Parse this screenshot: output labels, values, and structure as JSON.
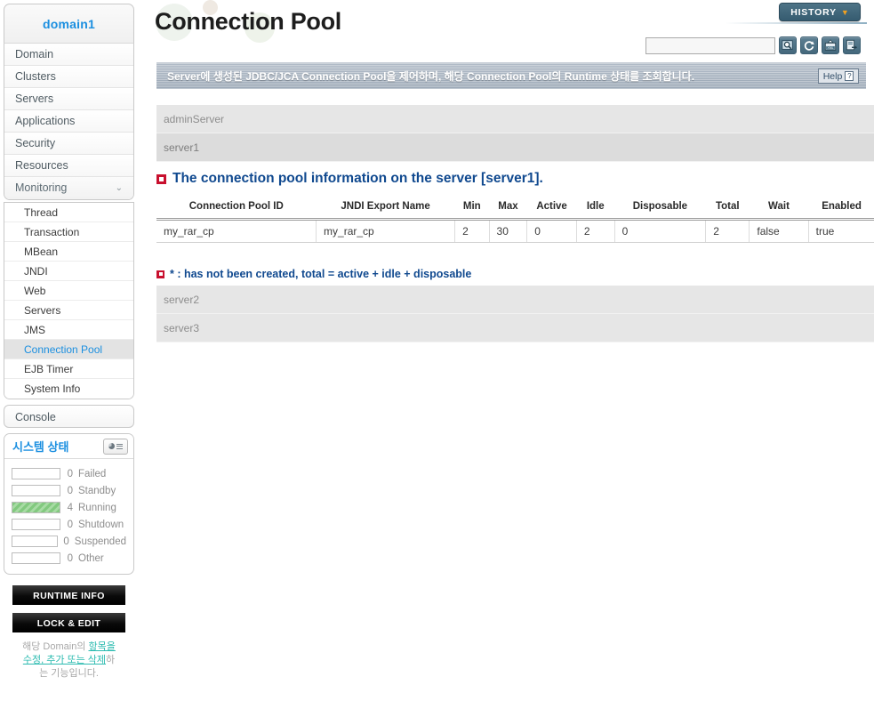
{
  "sidebar": {
    "domain_label": "domain1",
    "nav_items": [
      {
        "label": "Domain",
        "expandable": false
      },
      {
        "label": "Clusters",
        "expandable": false
      },
      {
        "label": "Servers",
        "expandable": false
      },
      {
        "label": "Applications",
        "expandable": false
      },
      {
        "label": "Security",
        "expandable": false
      },
      {
        "label": "Resources",
        "expandable": false
      },
      {
        "label": "Monitoring",
        "expandable": true,
        "chevron": "chevron-down-icon"
      }
    ],
    "sub_items": [
      {
        "label": "Thread",
        "active": false
      },
      {
        "label": "Transaction",
        "active": false
      },
      {
        "label": "MBean",
        "active": false
      },
      {
        "label": "JNDI",
        "active": false
      },
      {
        "label": "Web",
        "active": false
      },
      {
        "label": "Servers",
        "active": false
      },
      {
        "label": "JMS",
        "active": false
      },
      {
        "label": "Connection Pool",
        "active": true
      },
      {
        "label": "EJB Timer",
        "active": false
      },
      {
        "label": "System Info",
        "active": false
      }
    ],
    "console_label": "Console",
    "system_status": {
      "title": "시스템 상태",
      "icon": "monitor-chart-icon",
      "rows": [
        {
          "label": "Failed",
          "count": "0",
          "filled": false
        },
        {
          "label": "Standby",
          "count": "0",
          "filled": false
        },
        {
          "label": "Running",
          "count": "4",
          "filled": true
        },
        {
          "label": "Shutdown",
          "count": "0",
          "filled": false
        },
        {
          "label": "Suspended",
          "count": "0",
          "filled": false
        },
        {
          "label": "Other",
          "count": "0",
          "filled": false
        }
      ],
      "fill_color": "#82c97f"
    },
    "runtime_info_label": "RUNTIME INFO",
    "lock_edit_label": "LOCK & EDIT",
    "hint_prefix": "해당 Domain의 ",
    "hint_link": "항목을 수정, 추가 또는 삭제",
    "hint_suffix": "하는 기능입니다."
  },
  "header": {
    "page_title": "Connection Pool",
    "history_label": "HISTORY",
    "history_caret": "chevron-down-icon",
    "search_value": "",
    "search_placeholder": "",
    "toolbar_buttons": [
      {
        "name": "search-icon",
        "glyph": "search"
      },
      {
        "name": "refresh-icon",
        "glyph": "refresh"
      },
      {
        "name": "export-xml-icon",
        "glyph": "xml"
      },
      {
        "name": "export-data-icon",
        "glyph": "export"
      }
    ],
    "description": "Server에 생성된 JDBC/JCA Connection Pool을 제어하며, 해당 Connection Pool의 Runtime 상태를 조회합니다.",
    "help_label": "Help",
    "help_mark": "?"
  },
  "main": {
    "servers_top": [
      {
        "label": "adminServer",
        "selected": false
      },
      {
        "label": "server1",
        "selected": true
      }
    ],
    "section_title": "The connection pool information on the server [server1].",
    "note": "* : has not been created, total = active + idle + disposable",
    "servers_bottom": [
      {
        "label": "server2",
        "selected": false
      },
      {
        "label": "server3",
        "selected": false
      }
    ],
    "table": {
      "columns": [
        "Connection Pool ID",
        "JNDI Export Name",
        "Min",
        "Max",
        "Active",
        "Idle",
        "Disposable",
        "Total",
        "Wait",
        "Enabled"
      ],
      "rows": [
        [
          "my_rar_cp",
          "my_rar_cp",
          "2",
          "30",
          "0",
          "2",
          "0",
          "2",
          "false",
          "true"
        ]
      ]
    }
  },
  "colors": {
    "accent_blue": "#1b8fe0",
    "heading_blue": "#10498f",
    "bullet_red": "#c8102e",
    "history_teal": "#3f6a80",
    "running_green": "#82c97f"
  }
}
